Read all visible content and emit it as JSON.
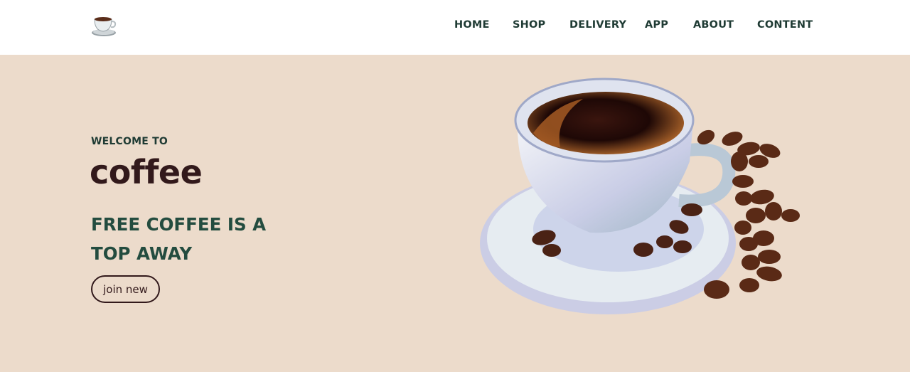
{
  "header": {
    "logo_icon": "coffee-cup-icon",
    "nav": [
      {
        "label": "HOME"
      },
      {
        "label": "SHOP"
      },
      {
        "label": "DELIVERY"
      },
      {
        "label": "APP"
      },
      {
        "label": "ABOUT"
      },
      {
        "label": "CONTENT"
      }
    ]
  },
  "hero": {
    "welcome": "WELCOME TO",
    "title": "coffee",
    "tagline": "FREE COFFEE IS A TOP AWAY",
    "button_label": "join new",
    "image": "coffee-cup-with-beans-illustration"
  },
  "colors": {
    "hero_bg": "#ecdbcb",
    "nav_text": "#1f3b34",
    "title": "#32191b",
    "tagline": "#234c3f"
  }
}
